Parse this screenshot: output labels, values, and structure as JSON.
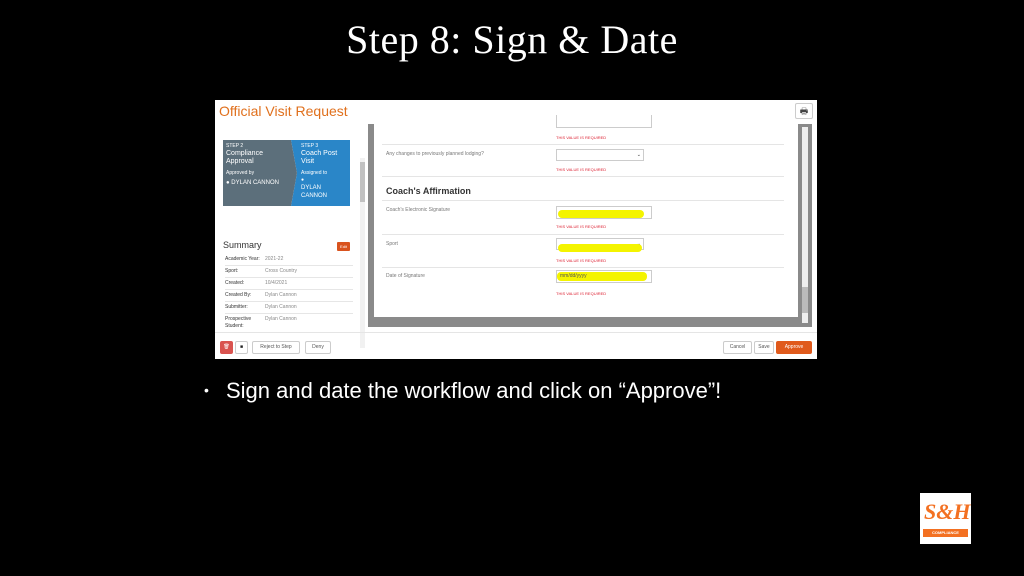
{
  "slide": {
    "title": "Step 8: Sign & Date",
    "bullet": "Sign and date the workflow and click on “Approve”!",
    "logo_text": "S&H",
    "logo_caption": "COMPLIANCE"
  },
  "window": {
    "title": "Official Visit Request",
    "print_icon": "printer-icon"
  },
  "steps": {
    "prev": {
      "step": "STEP 2",
      "name": "Compliance Approval",
      "by_label": "Approved by",
      "by_name": "DYLAN CANNON"
    },
    "current": {
      "step": "STEP 3",
      "name": "Coach Post Visit",
      "to_label": "Assigned to",
      "to_name": "DYLAN CANNON"
    }
  },
  "summary": {
    "title": "Summary",
    "edit_label": "Edit",
    "rows": [
      {
        "key": "Academic Year:",
        "value": "2021-22"
      },
      {
        "key": "Sport:",
        "value": "Cross Country"
      },
      {
        "key": "Created:",
        "value": "10/4/2021"
      },
      {
        "key": "Created By:",
        "value": "Dylan Cannon"
      },
      {
        "key": "Submitter:",
        "value": "Dylan Cannon"
      },
      {
        "key": "Prospective Student:",
        "value": "Dylan Cannon"
      }
    ]
  },
  "form": {
    "required_msg": "THIS VALUE IS REQUIRED",
    "lodging_label": "Any changes to previously planned lodging?",
    "section_title": "Coach's Affirmation",
    "signature_label": "Coach's Electronic Signature",
    "sport_label": "Sport",
    "date_label": "Date of Signature",
    "date_placeholder": "mm/dd/yyyy"
  },
  "footer": {
    "reject_label": "Reject to Step",
    "deny_label": "Deny",
    "cancel_label": "Cancel",
    "save_label": "Save",
    "approve_label": "Approve"
  },
  "colors": {
    "accent": "#e0701d",
    "approve": "#e05a1c",
    "step_current": "#2a86c8",
    "step_prev": "#5c6f7b",
    "highlight": "#f4f400",
    "error": "#dd2233"
  }
}
